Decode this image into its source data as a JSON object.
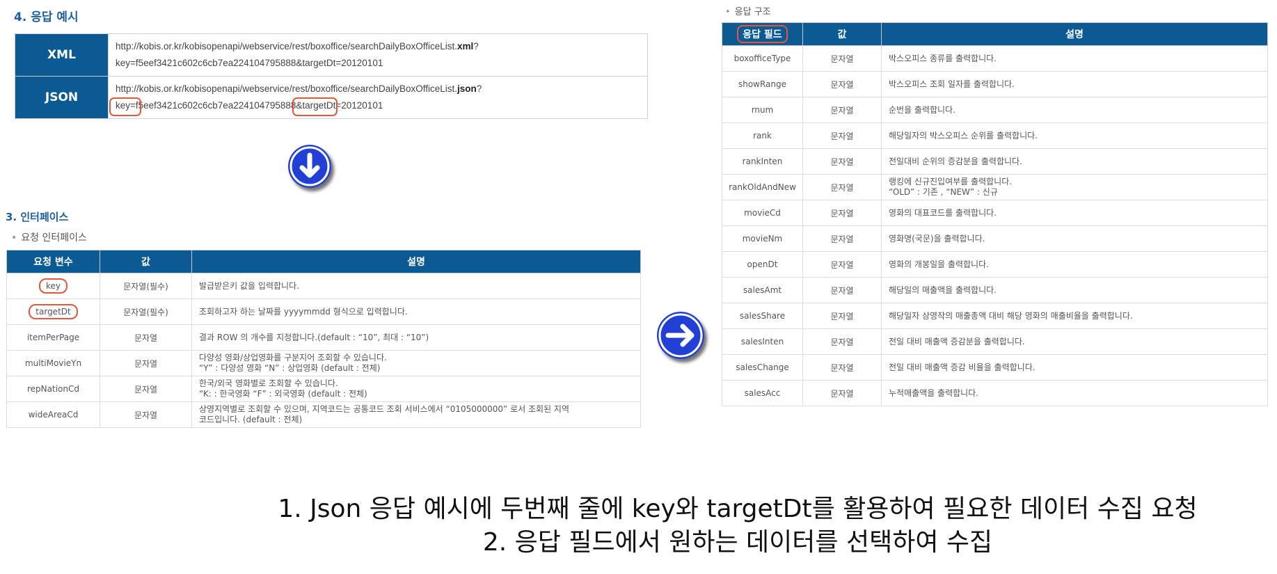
{
  "response_example": {
    "title": "4. 응답 예시",
    "rows": [
      {
        "label": "XML",
        "line1_prefix": "http://kobis.or.kr/kobisopenapi/webservice/rest/boxoffice/searchDailyBoxOfficeList.",
        "line1_ext": "xml",
        "line1_suffix": "?",
        "line2": "key=f5eef3421c602c6cb7ea224104795888&targetDt=20120101"
      },
      {
        "label": "JSON",
        "line1_prefix": "http://kobis.or.kr/kobisopenapi/webservice/rest/boxoffice/searchDailyBoxOfficeList.",
        "line1_ext": "json",
        "line1_suffix": "?",
        "line2": "key=f5eef3421c602c6cb7ea224104795888&targetDt=20120101"
      }
    ]
  },
  "interface": {
    "title": "3. 인터페이스",
    "subtitle": "요청 인터페이스",
    "headers": [
      "요청 변수",
      "값",
      "설명"
    ],
    "rows": [
      {
        "name": "key",
        "value": "문자열(필수)",
        "desc": [
          "발급받은키 값을 입력합니다."
        ]
      },
      {
        "name": "targetDt",
        "value": "문자열(필수)",
        "desc": [
          "조회하고자 하는 날짜를 yyyymmdd 형식으로 입력합니다."
        ]
      },
      {
        "name": "itemPerPage",
        "value": "문자열",
        "desc": [
          "결과 ROW 의 개수를 지정합니다.(default : “10”, 최대 : “10”)"
        ]
      },
      {
        "name": "multiMovieYn",
        "value": "문자열",
        "desc": [
          "다양성 영화/상업영화를 구분지어 조회할 수 있습니다.",
          "“Y” : 다양성 영화 “N” : 상업영화 (default : 전체)"
        ]
      },
      {
        "name": "repNationCd",
        "value": "문자열",
        "desc": [
          "한국/외국 영화별로 조회할 수 있습니다.",
          "“K: : 한국영화 “F” : 외국영화 (default : 전체)"
        ]
      },
      {
        "name": "wideAreaCd",
        "value": "문자열",
        "desc": [
          "상영지역별로 조회할 수 있으며, 지역코드는 공통코드 조회 서비스에서 “0105000000” 로서 조회된 지역",
          "코드입니다. (default : 전체)"
        ]
      }
    ]
  },
  "response_structure": {
    "subtitle": "응답 구조",
    "headers": [
      "응답 필드",
      "값",
      "설명"
    ],
    "rows": [
      {
        "name": "boxofficeType",
        "value": "문자열",
        "desc": [
          "박스오피스 종류를 출력합니다."
        ]
      },
      {
        "name": "showRange",
        "value": "문자열",
        "desc": [
          "박스오피스 조회 일자를 출력합니다."
        ]
      },
      {
        "name": "rnum",
        "value": "문자열",
        "desc": [
          "순번을 출력합니다."
        ]
      },
      {
        "name": "rank",
        "value": "문자열",
        "desc": [
          "해당일자의 박스오피스 순위를 출력합니다."
        ]
      },
      {
        "name": "rankInten",
        "value": "문자열",
        "desc": [
          "전일대비 순위의 증감분을 출력합니다."
        ]
      },
      {
        "name": "rankOldAndNew",
        "value": "문자열",
        "desc": [
          "랭킹에 신규진입여부를 출력합니다.",
          "“OLD” : 기존 , “NEW” : 신규"
        ]
      },
      {
        "name": "movieCd",
        "value": "문자열",
        "desc": [
          "영화의 대표코드를 출력합니다."
        ]
      },
      {
        "name": "movieNm",
        "value": "문자열",
        "desc": [
          "영화명(국문)을 출력합니다."
        ]
      },
      {
        "name": "openDt",
        "value": "문자열",
        "desc": [
          "영화의 개봉일을 출력합니다."
        ]
      },
      {
        "name": "salesAmt",
        "value": "문자열",
        "desc": [
          "해당일의 매출액을 출력합니다."
        ]
      },
      {
        "name": "salesShare",
        "value": "문자열",
        "desc": [
          "해당일자 상영작의 매출총액 대비 해당 영화의 매출비율을 출력합니다."
        ]
      },
      {
        "name": "salesInten",
        "value": "문자열",
        "desc": [
          "전일 대비 매출액 증감분을 출력합니다."
        ]
      },
      {
        "name": "salesChange",
        "value": "문자열",
        "desc": [
          "전일 대비 매출액 증감 비율을 출력합니다."
        ]
      },
      {
        "name": "salesAcc",
        "value": "문자열",
        "desc": [
          "누적매출액을 출력합니다."
        ]
      }
    ]
  },
  "caption": {
    "line1": "1. Json 응답 예시에 두번째 줄에 key와 targetDt를 활용하여 필요한 데이터 수집 요청",
    "line2": "2. 응답 필드에서 원하는 데이터를 선택하여 수집"
  },
  "colors": {
    "header_blue": "#0b5a94",
    "highlight_red": "#e5563a",
    "arrow_blue": "#2240d6"
  },
  "icons": [
    "arrow-down-icon",
    "arrow-right-icon"
  ]
}
